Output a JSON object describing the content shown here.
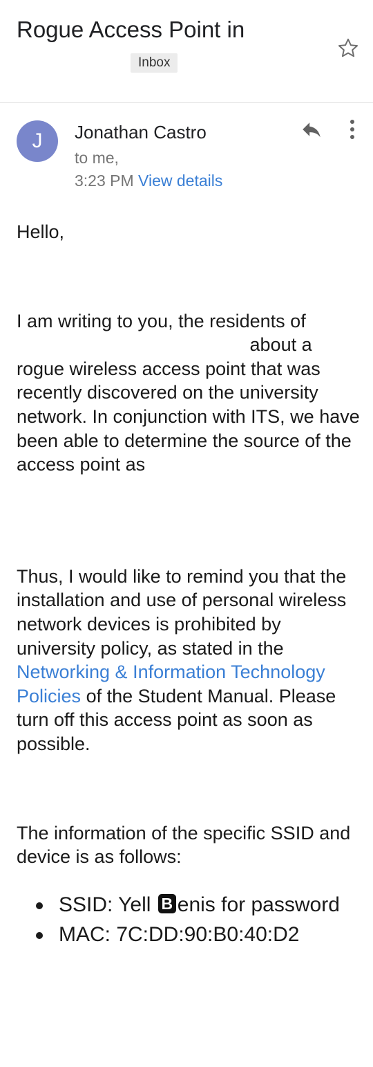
{
  "header": {
    "subject": "Rogue Access Point in",
    "label": "Inbox"
  },
  "message": {
    "avatar_letter": "J",
    "sender": "Jonathan Castro",
    "recipients": "to me,",
    "time": "3:23 PM",
    "view_details": "View details"
  },
  "body": {
    "greeting": "Hello,",
    "p1_start": "I am writing to you, the residents of",
    "p1_rest": "about a rogue wireless access point that was recently discovered on the university network. In conjunction with ITS, we have been able to determine the source of the access point as",
    "p2_start": "Thus, I would like to remind you that the installation and use of personal wireless network devices is prohibited by university policy, as stated in the",
    "p2_link": "Networking & Information Technology Policies",
    "p2_end": "of the Student Manual. Please turn off this access point as soon as possible.",
    "p3": "The information of the specific SSID and device is as follows:",
    "bullets": {
      "ssid_pre": "SSID: Yell",
      "ssid_boxed": "B",
      "ssid_post": "enis for password",
      "mac": "MAC: 7C:DD:90:B0:40:D2"
    }
  },
  "icons": {
    "star": "star-outline-icon",
    "reply": "reply-icon",
    "more": "more-vert-icon"
  },
  "colors": {
    "avatar": "#7986cb",
    "link": "#3a7fd5",
    "label_bg": "#ececec"
  }
}
